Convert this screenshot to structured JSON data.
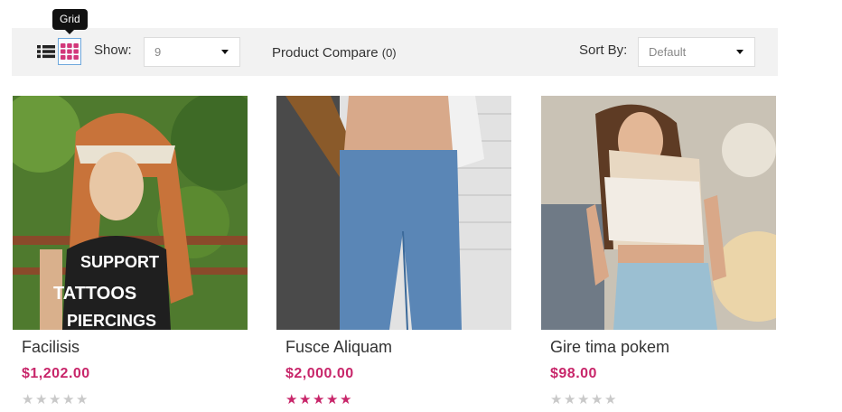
{
  "toolbar": {
    "tooltip": "Grid",
    "show_label": "Show:",
    "show_value": "9",
    "compare_label": "Product Compare",
    "compare_count": "(0)",
    "sort_label": "Sort By:",
    "sort_value": "Default"
  },
  "colors": {
    "accent": "#c8266a",
    "star_empty": "#c9c9c9",
    "grid_icon": "#d2377a"
  },
  "products": [
    {
      "name": "Facilisis",
      "price": "$1,202.00",
      "rating": 0
    },
    {
      "name": "Fusce Aliquam",
      "price": "$2,000.00",
      "rating": 5
    },
    {
      "name": "Gire tima pokem",
      "price": "$98.00",
      "rating": 0
    }
  ]
}
